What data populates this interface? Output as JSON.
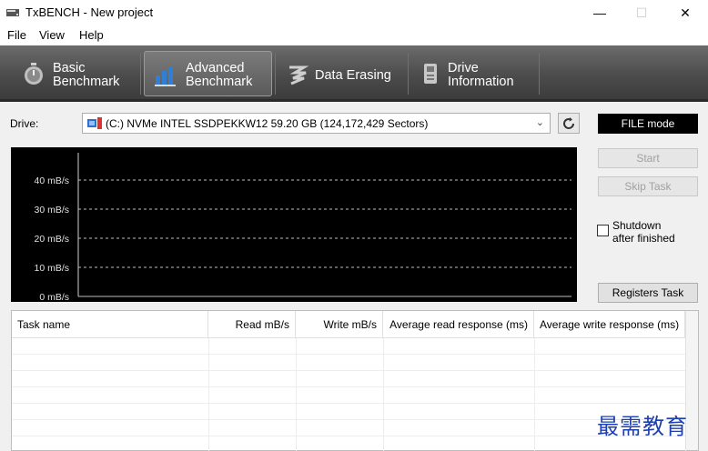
{
  "window": {
    "title": "TxBENCH - New project",
    "minimize": "—",
    "maximize": "☐",
    "close": "✕"
  },
  "menu": {
    "file": "File",
    "view": "View",
    "help": "Help"
  },
  "toolbar": {
    "basic": {
      "line1": "Basic",
      "line2": "Benchmark",
      "icon": "stopwatch-icon"
    },
    "advanced": {
      "line1": "Advanced",
      "line2": "Benchmark",
      "icon": "bar-chart-icon",
      "selected": true
    },
    "erasing": {
      "line1": "Data Erasing",
      "icon": "eraser-icon"
    },
    "info": {
      "line1": "Drive",
      "line2": "Information",
      "icon": "drive-icon"
    }
  },
  "drive": {
    "label": "Drive:",
    "selected": "(C:) NVMe INTEL SSDPEKKW12  59.20 GB (124,172,429 Sectors)"
  },
  "side": {
    "mode": "FILE mode",
    "start": "Start",
    "skip": "Skip Task",
    "shutdown_line1": "Shutdown",
    "shutdown_line2": "after finished",
    "shutdown_checked": false,
    "registers": "Registers Task"
  },
  "graph": {
    "y_labels": [
      "40 mB/s",
      "30 mB/s",
      "20 mB/s",
      "10 mB/s",
      "0 mB/s"
    ],
    "y_values": [
      40,
      30,
      20,
      10,
      0
    ],
    "background": "#000000",
    "grid_color": "#bdbdbd"
  },
  "table": {
    "headers": [
      "Task name",
      "Read mB/s",
      "Write mB/s",
      "Average read response (ms)",
      "Average write response (ms)"
    ],
    "rows": []
  },
  "watermark": "最需教育"
}
